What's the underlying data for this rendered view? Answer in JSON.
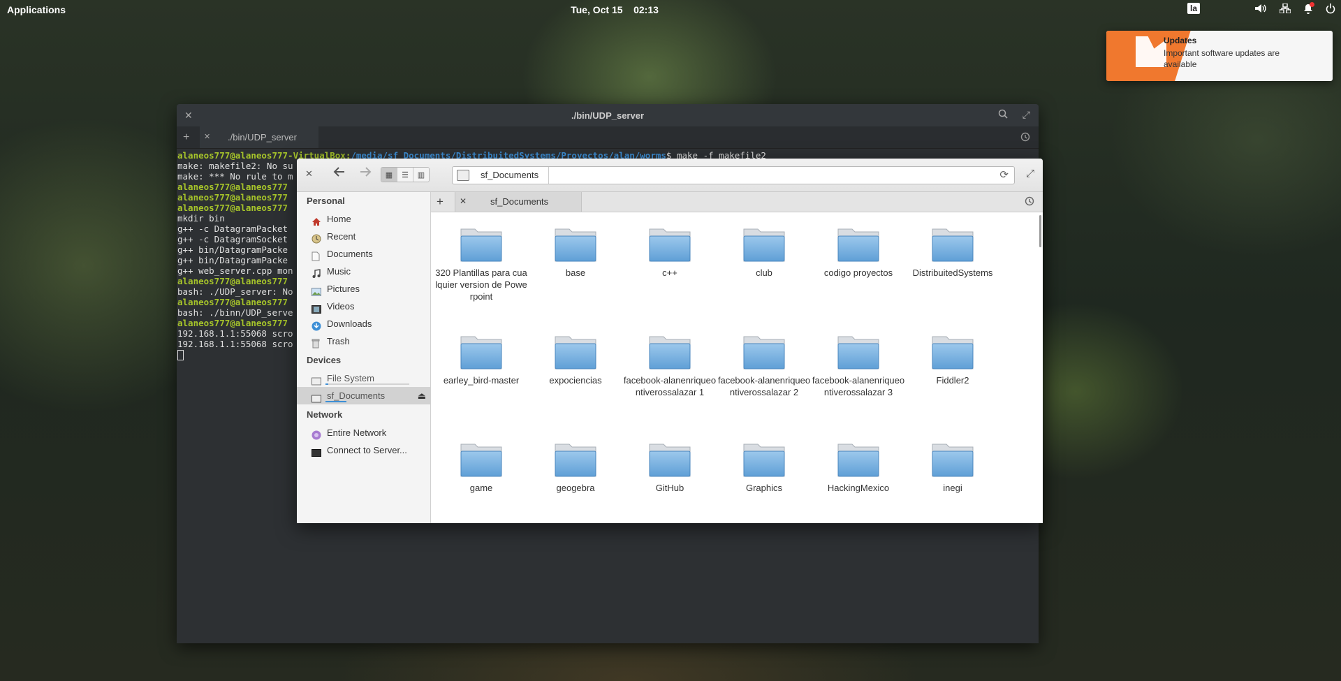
{
  "panel": {
    "applications": "Applications",
    "clock": "Tue, Oct 15    02:13",
    "keyboard": "la"
  },
  "notification": {
    "title": "Updates",
    "body": "Important software updates are available"
  },
  "terminal": {
    "title": "./bin/UDP_server",
    "tab_label": "./bin/UDP_server",
    "lines": [
      {
        "prompt": "alaneos777@alaneos777-VirtualBox:",
        "path": "/media/sf_Documents/DistribuitedSystems/Proyectos/alan/worms",
        "text": "$ make -f makefile2"
      },
      {
        "text": "make: makefile2: No su"
      },
      {
        "text": "make: *** No rule to m"
      },
      {
        "prompt": "alaneos777@alaneos777",
        "text": ""
      },
      {
        "prompt": "alaneos777@alaneos777",
        "text": ""
      },
      {
        "prompt": "alaneos777@alaneos777",
        "text": ""
      },
      {
        "text": "mkdir bin"
      },
      {
        "text": "g++ -c DatagramPacket"
      },
      {
        "text": "g++ -c DatagramSocket"
      },
      {
        "text": "g++ bin/DatagramPacke"
      },
      {
        "text": "g++ bin/DatagramPacke"
      },
      {
        "text": "g++ web_server.cpp mon"
      },
      {
        "prompt": "alaneos777@alaneos777",
        "text": ""
      },
      {
        "text": "bash: ./UDP_server: No"
      },
      {
        "prompt": "alaneos777@alaneos777",
        "text": ""
      },
      {
        "text": "bash: ./binn/UDP_serve"
      },
      {
        "prompt": "alaneos777@alaneos777",
        "text": ""
      },
      {
        "text": "192.168.1.1:55068 scro"
      },
      {
        "text": "192.168.1.1:55068 scro"
      }
    ]
  },
  "files": {
    "location": "sf_Documents",
    "tab_label": "sf_Documents",
    "sidebar": {
      "personal_header": "Personal",
      "personal": [
        "Home",
        "Recent",
        "Documents",
        "Music",
        "Pictures",
        "Videos",
        "Downloads",
        "Trash"
      ],
      "devices_header": "Devices",
      "devices": [
        "File System",
        "sf_Documents"
      ],
      "network_header": "Network",
      "network": [
        "Entire Network",
        "Connect to Server..."
      ]
    },
    "folders": [
      "320 Plantillas para cualquier version de Powerpoint",
      "base",
      "c++",
      "club",
      "codigo proyectos",
      "DistribuitedSystems",
      "earley_bird-master",
      "expociencias",
      "facebook-alanenriqueontiverossalazar 1",
      "facebook-alanenriqueontiverossalazar 2",
      "facebook-alanenriqueontiverossalazar 3",
      "Fiddler2",
      "game",
      "geogebra",
      "GitHub",
      "Graphics",
      "HackingMexico",
      "inegi"
    ]
  },
  "colors": {
    "prompt_green": "#a6c42a",
    "path_blue": "#3d8fd6",
    "folder_blue": "#7ab3e0",
    "notification_orange": "#f0782e"
  }
}
